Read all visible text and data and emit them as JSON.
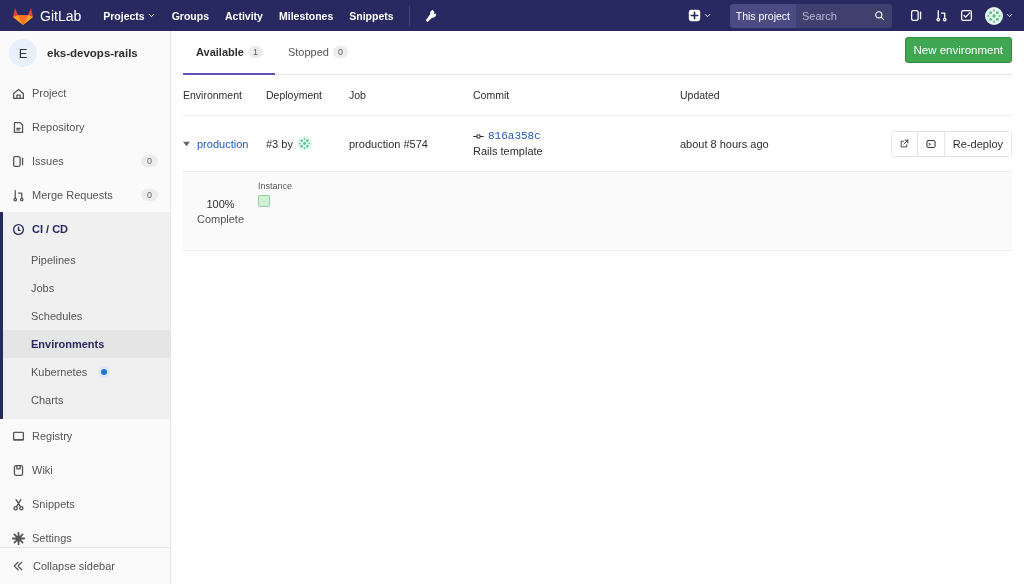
{
  "topbar": {
    "brand": "GitLab",
    "links": [
      {
        "label": "Projects",
        "dropdown": true
      },
      {
        "label": "Groups",
        "dropdown": false
      },
      {
        "label": "Activity",
        "dropdown": false
      },
      {
        "label": "Milestones",
        "dropdown": false
      },
      {
        "label": "Snippets",
        "dropdown": false
      }
    ],
    "search": {
      "scope": "This project",
      "placeholder": "Search"
    }
  },
  "sidebar": {
    "project": {
      "initial": "E",
      "name": "eks-devops-rails"
    },
    "items": [
      {
        "label": "Project",
        "selected": false
      },
      {
        "label": "Repository",
        "selected": false
      },
      {
        "label": "Issues",
        "count": "0",
        "selected": false
      },
      {
        "label": "Merge Requests",
        "count": "0",
        "selected": false
      },
      {
        "label": "CI / CD",
        "selected": true,
        "children": [
          {
            "label": "Pipelines",
            "selected": false,
            "dot": false
          },
          {
            "label": "Jobs",
            "selected": false,
            "dot": false
          },
          {
            "label": "Schedules",
            "selected": false,
            "dot": false
          },
          {
            "label": "Environments",
            "selected": true,
            "dot": false
          },
          {
            "label": "Kubernetes",
            "selected": false,
            "dot": true
          },
          {
            "label": "Charts",
            "selected": false,
            "dot": false
          }
        ]
      },
      {
        "label": "Registry",
        "selected": false
      },
      {
        "label": "Wiki",
        "selected": false
      },
      {
        "label": "Snippets",
        "selected": false
      },
      {
        "label": "Settings",
        "selected": false
      }
    ],
    "collapse": "Collapse sidebar"
  },
  "tabs": [
    {
      "label": "Available",
      "count": "1",
      "selected": true
    },
    {
      "label": "Stopped",
      "count": "0",
      "selected": false
    }
  ],
  "new_button": "New environment",
  "table": {
    "columns": [
      "Environment",
      "Deployment",
      "Job",
      "Commit",
      "Updated"
    ],
    "rows": [
      {
        "environment": "production",
        "expanded": true,
        "deployment": "#3 by",
        "job": "production #574",
        "commit_sha": "816a358c",
        "commit_title": "Rails template",
        "updated": "about 8 hours ago",
        "redeploy": "Re-deploy",
        "details": {
          "percent": "100%",
          "status": "Complete",
          "instances_label": "Instance",
          "instances": [
            {
              "color": "#d1f0d6"
            }
          ]
        }
      }
    ]
  }
}
